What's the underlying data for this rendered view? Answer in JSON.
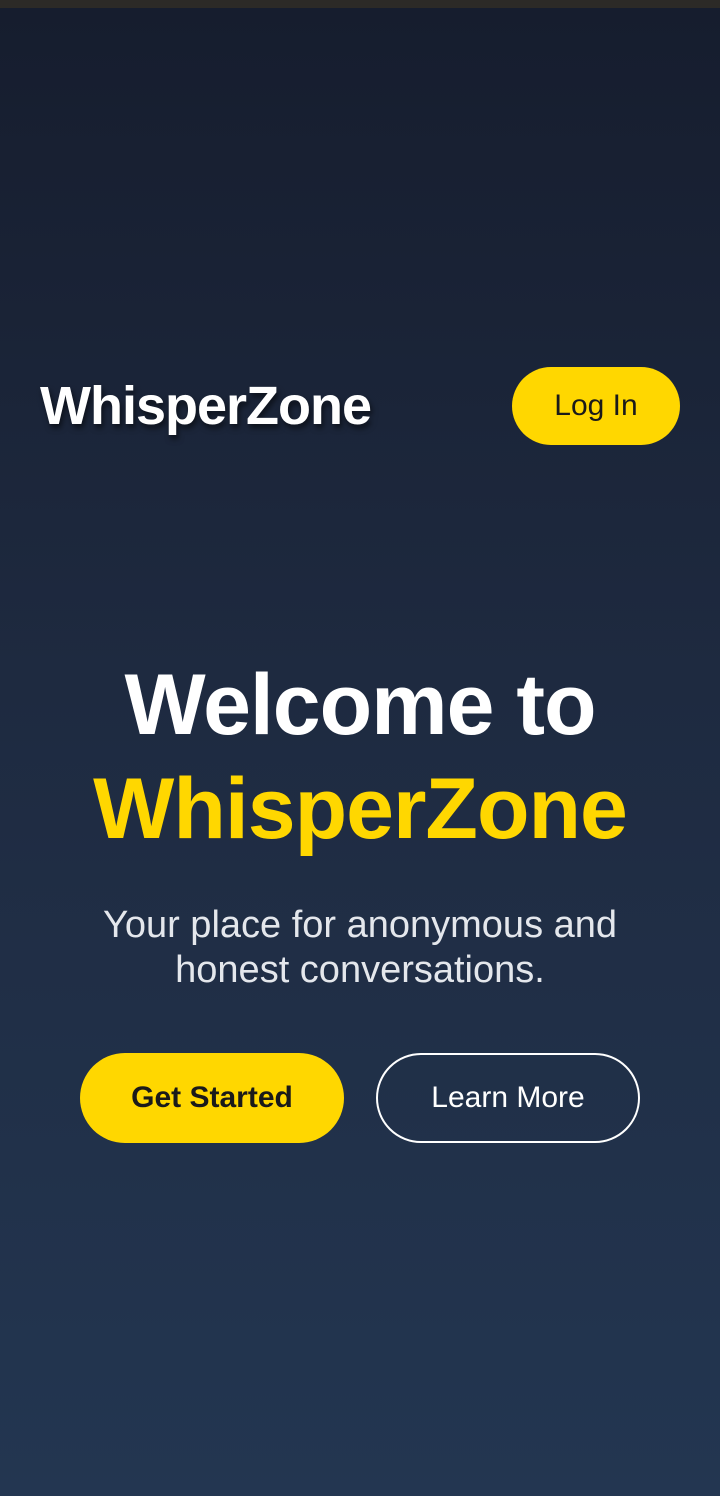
{
  "header": {
    "logo": "WhisperZone",
    "login_label": "Log In"
  },
  "hero": {
    "title_line1": "Welcome to",
    "title_line2": "WhisperZone",
    "subtitle": "Your place for anonymous and honest conversations."
  },
  "actions": {
    "get_started_label": "Get Started",
    "learn_more_label": "Learn More"
  },
  "colors": {
    "accent": "#ffd700",
    "background_top": "#161d2e",
    "background_bottom": "#233651",
    "text_primary": "#ffffff",
    "text_secondary": "#e4e7ec"
  }
}
